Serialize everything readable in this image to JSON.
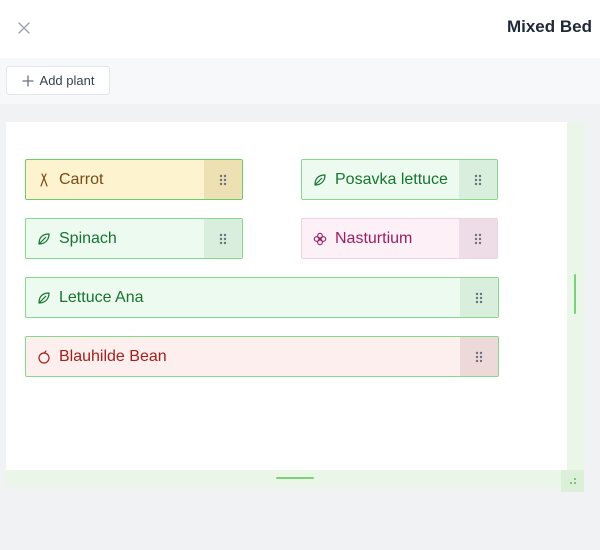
{
  "header": {
    "title": "Mixed Bed",
    "close_icon": "close-icon"
  },
  "toolbar": {
    "add_label": "Add plant",
    "add_icon": "plus-icon"
  },
  "plants": [
    {
      "label": "Carrot",
      "icon": "carrot-icon",
      "color": "#7a4a17"
    },
    {
      "label": "Posavka lettuce",
      "icon": "leaf-icon",
      "color": "#17742f"
    },
    {
      "label": "Spinach",
      "icon": "leaf-icon",
      "color": "#17742f"
    },
    {
      "label": "Nasturtium",
      "icon": "flower-icon",
      "color": "#9a1f62"
    },
    {
      "label": "Lettuce Ana",
      "icon": "leaf-icon",
      "color": "#17742f"
    },
    {
      "label": "Blauhilde Bean",
      "icon": "bean-icon",
      "color": "#a3201e"
    }
  ],
  "colors": {
    "accent_green": "#6dcd6b",
    "leafy_bg": "#edfaef",
    "carrot_bg": "#fdf4cf",
    "flower_bg": "#fdf0f7",
    "bean_bg": "#fcefee"
  }
}
